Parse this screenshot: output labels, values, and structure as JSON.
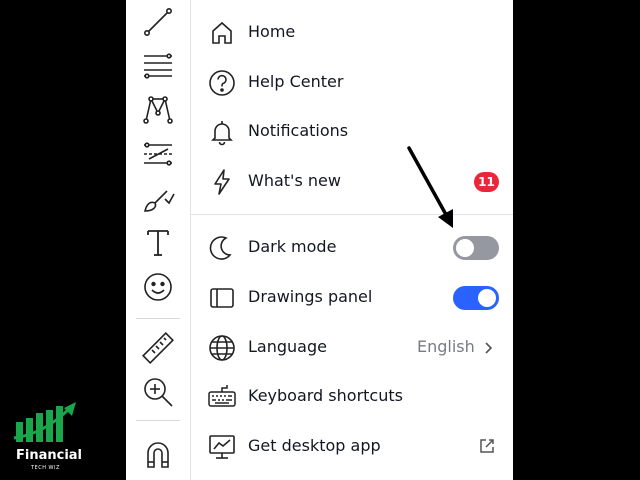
{
  "menu": {
    "home": "Home",
    "help_center": "Help Center",
    "notifications": "Notifications",
    "whats_new": "What's new",
    "whats_new_badge": "11",
    "dark_mode": "Dark mode",
    "dark_mode_on": false,
    "drawings_panel": "Drawings panel",
    "drawings_panel_on": true,
    "language": "Language",
    "language_value": "English",
    "keyboard_shortcuts": "Keyboard shortcuts",
    "get_desktop_app": "Get desktop app"
  },
  "toolbar": {
    "icons": [
      "trend-line-icon",
      "fib-retracement-icon",
      "pattern-icon",
      "projection-icon",
      "brush-icon",
      "text-icon",
      "emoji-icon",
      "ruler-icon",
      "zoom-in-icon",
      "magnet-icon"
    ]
  },
  "logo": {
    "name": "Financial",
    "sub": "TECH WIZ"
  },
  "colors": {
    "accent": "#2962ff",
    "badge": "#e8283a",
    "toggle_off": "#9598a1",
    "logo_green": "#1aa64a"
  }
}
